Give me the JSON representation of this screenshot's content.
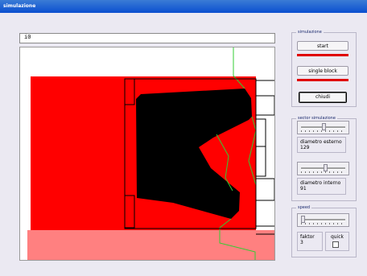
{
  "window": {
    "title": "simulazione"
  },
  "input": {
    "value": "i0"
  },
  "colors": {
    "stock_red": "#ff0000",
    "stock_light_red": "#ff8080",
    "tool_black": "#000000",
    "path_green": "#33cc33"
  },
  "controls": {
    "simulazione": {
      "label": "simulazione",
      "start_label": "start",
      "single_block_label": "single block",
      "chiudi_label": "chiudi"
    },
    "sector": {
      "label": "sector simulazione",
      "diametro_esterno_label": "diametro esterno",
      "diametro_esterno_value": "129",
      "diametro_interno_label": "diametro interno",
      "diametro_interno_value": "91"
    },
    "speed": {
      "label": "speed",
      "faktor_label": "faktor",
      "faktor_value": "3",
      "quick_label": "quick"
    }
  }
}
